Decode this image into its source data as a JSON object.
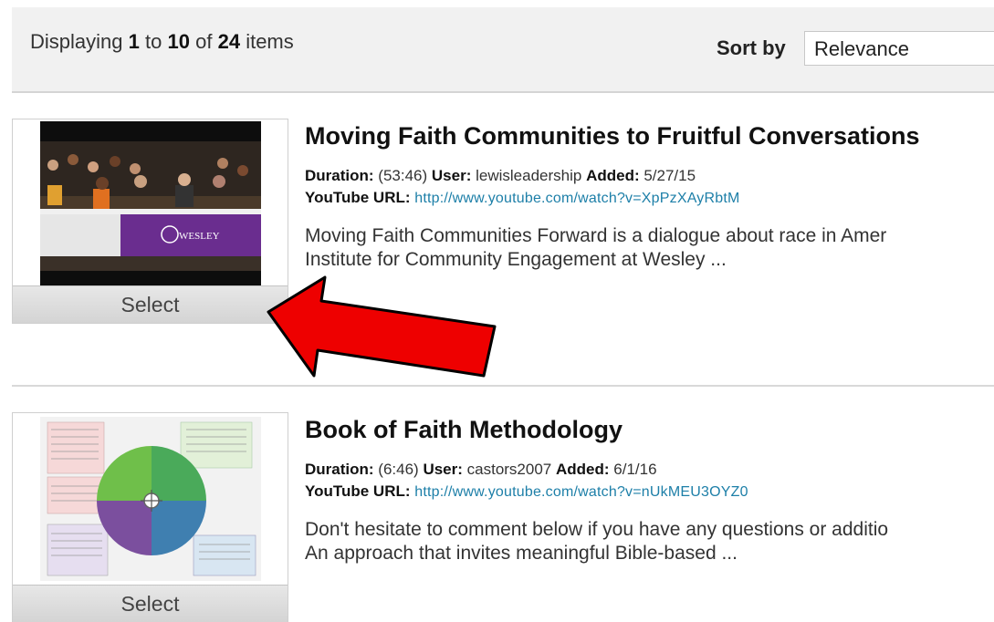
{
  "header": {
    "display_prefix": "Displaying",
    "range_start": "1",
    "to_word": "to",
    "range_end": "10",
    "of_word": "of",
    "total": "24",
    "items_word": "items",
    "sort_label": "Sort by",
    "sort_value": "Relevance"
  },
  "items": [
    {
      "title": "Moving Faith Communities to Fruitful Conversations",
      "duration_label": "Duration:",
      "duration": "(53:46)",
      "user_label": "User:",
      "user": "lewisleadership",
      "added_label": "Added:",
      "added": "5/27/15",
      "url_label": "YouTube URL:",
      "url": "http://www.youtube.com/watch?v=XpPzXAyRbtM",
      "desc_line1": "Moving Faith Communities Forward is a dialogue about race in Amer",
      "desc_line2": "Institute for Community Engagement at Wesley ...",
      "select_label": "Select",
      "thumb_text": "WESLEY"
    },
    {
      "title": "Book of Faith Methodology",
      "duration_label": "Duration:",
      "duration": "(6:46)",
      "user_label": "User:",
      "user": "castors2007",
      "added_label": "Added:",
      "added": "6/1/16",
      "url_label": "YouTube URL:",
      "url": "http://www.youtube.com/watch?v=nUkMEU3OYZ0",
      "desc_line1": "Don't hesitate to comment below if you have any questions or additio",
      "desc_line2": "An approach that invites meaningful Bible-based ...",
      "select_label": "Select"
    }
  ],
  "colors": {
    "link": "#1d7fa8",
    "arrow_fill": "#ee0000",
    "wesley_banner": "#6a2d8f"
  }
}
